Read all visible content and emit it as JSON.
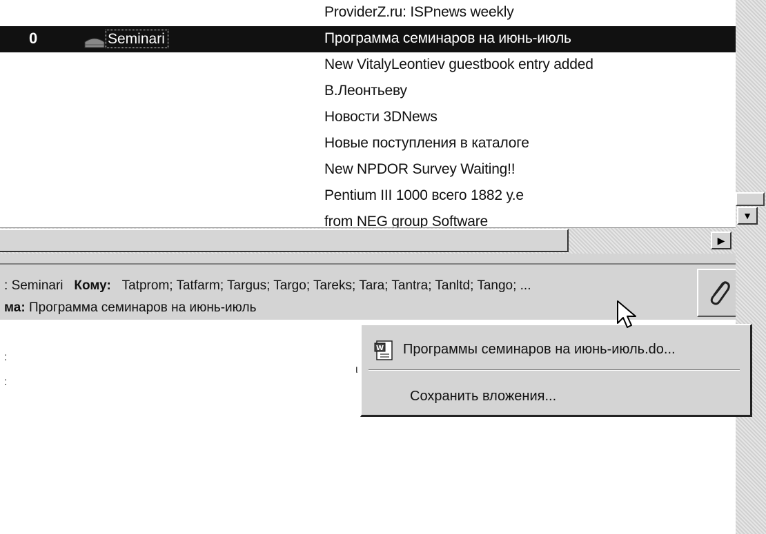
{
  "message_list": {
    "rows": [
      {
        "attachment": "",
        "from": "",
        "subject": "ProviderZ.ru: ISPnews weekly"
      },
      {
        "attachment": "0",
        "from": "Seminari",
        "subject": "Программа семинаров на июнь-июль",
        "selected": true
      },
      {
        "attachment": "",
        "from": "",
        "subject": "New VitalyLeontiev guestbook entry added"
      },
      {
        "attachment": "",
        "from": "",
        "subject": "В.Леонтьеву"
      },
      {
        "attachment": "",
        "from": "",
        "subject": "Новости 3DNews"
      },
      {
        "attachment": "",
        "from": "",
        "subject": "Новые поступления в каталоге"
      },
      {
        "attachment": "",
        "from": "",
        "subject": "New NPDOR Survey Waiting!!"
      },
      {
        "attachment": "",
        "from": "",
        "subject": "Pentium III 1000  всего 1882 у.е"
      },
      {
        "attachment": "",
        "from": "",
        "subject": "from NEG group Software"
      }
    ]
  },
  "preview_header": {
    "from_prefix": ":",
    "from_value": "Seminari",
    "to_label": "Кому:",
    "to_value": "Tatprom; Tatfarm; Targus; Targo; Tareks; Tara; Tantra; Tanltd; Tango; ...",
    "subject_label": "ма:",
    "subject_value": "Программа семинаров на июнь-июль"
  },
  "preview_body": {
    "tick1": ":",
    "tick2": ":",
    "fragment": "ι"
  },
  "attachment_menu": {
    "file_label": "Программы семинаров на июнь-июль.do...",
    "save_label": "Сохранить вложения..."
  },
  "icons": {
    "attachment": "paperclip-icon",
    "file": "word-document-icon",
    "flag": "envelope-icon"
  },
  "colors": {
    "selection": "#111111",
    "chrome": "#d4d4d4"
  }
}
